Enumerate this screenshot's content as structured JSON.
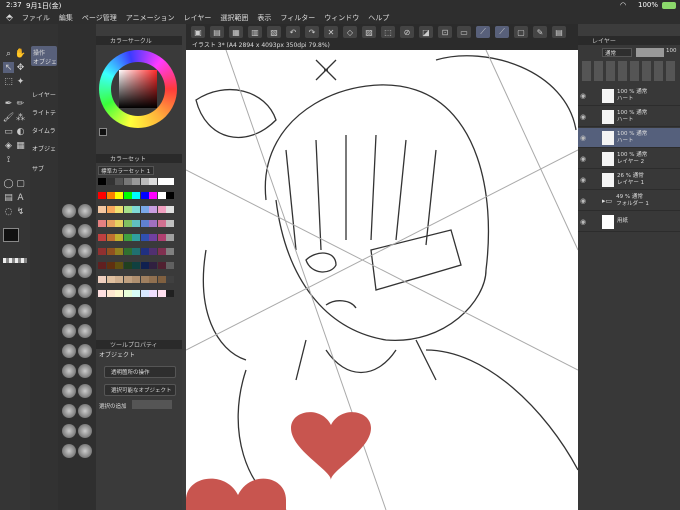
{
  "status": {
    "time": "2:37",
    "date": "9月1日(金)",
    "battery": "100%"
  },
  "menu": [
    "ファイル",
    "編集",
    "ページ管理",
    "アニメーション",
    "レイヤー",
    "選択範囲",
    "表示",
    "フィルター",
    "ウィンドウ",
    "ヘルプ"
  ],
  "canvas_tab": "イラスト 3* (A4 2894 x 4093px 350dpi 79.8%)",
  "tool_labels": {
    "operation": "操作",
    "object": "オブジェ",
    "layer": "レイヤー",
    "lighttable": "ライトテ",
    "timeline": "タイムラ",
    "object2": "オブジェ",
    "sub": "サブ"
  },
  "color_panel": {
    "title": "カラーサークル",
    "set_title": "カラーセット",
    "set_name": "標準カラーセット 1"
  },
  "tool_property": {
    "title": "ツールプロパティ",
    "tool": "オブジェクト",
    "transparent_op": "透明箇所の操作",
    "selectable": "選択可能なオブジェクト",
    "select_method": "選択の追加"
  },
  "layer_panel": {
    "title": "レイヤー",
    "blend": "通常",
    "opacity": "100",
    "layers": [
      {
        "opacity": "100 %",
        "mode": "通常",
        "name": "ハート"
      },
      {
        "opacity": "100 %",
        "mode": "通常",
        "name": "ハート"
      },
      {
        "opacity": "100 %",
        "mode": "通常",
        "name": "ハート"
      },
      {
        "opacity": "100 %",
        "mode": "通常",
        "name": "レイヤー 2"
      },
      {
        "opacity": "26 %",
        "mode": "通常",
        "name": "レイヤー 1"
      },
      {
        "opacity": "49 %",
        "mode": "通常",
        "name": "フォルダー 1"
      },
      {
        "opacity": "",
        "mode": "",
        "name": "用紙"
      }
    ]
  },
  "colors": {
    "accent": "#58607a",
    "heart": "#c8554f",
    "selected_layer": "#55607c"
  }
}
